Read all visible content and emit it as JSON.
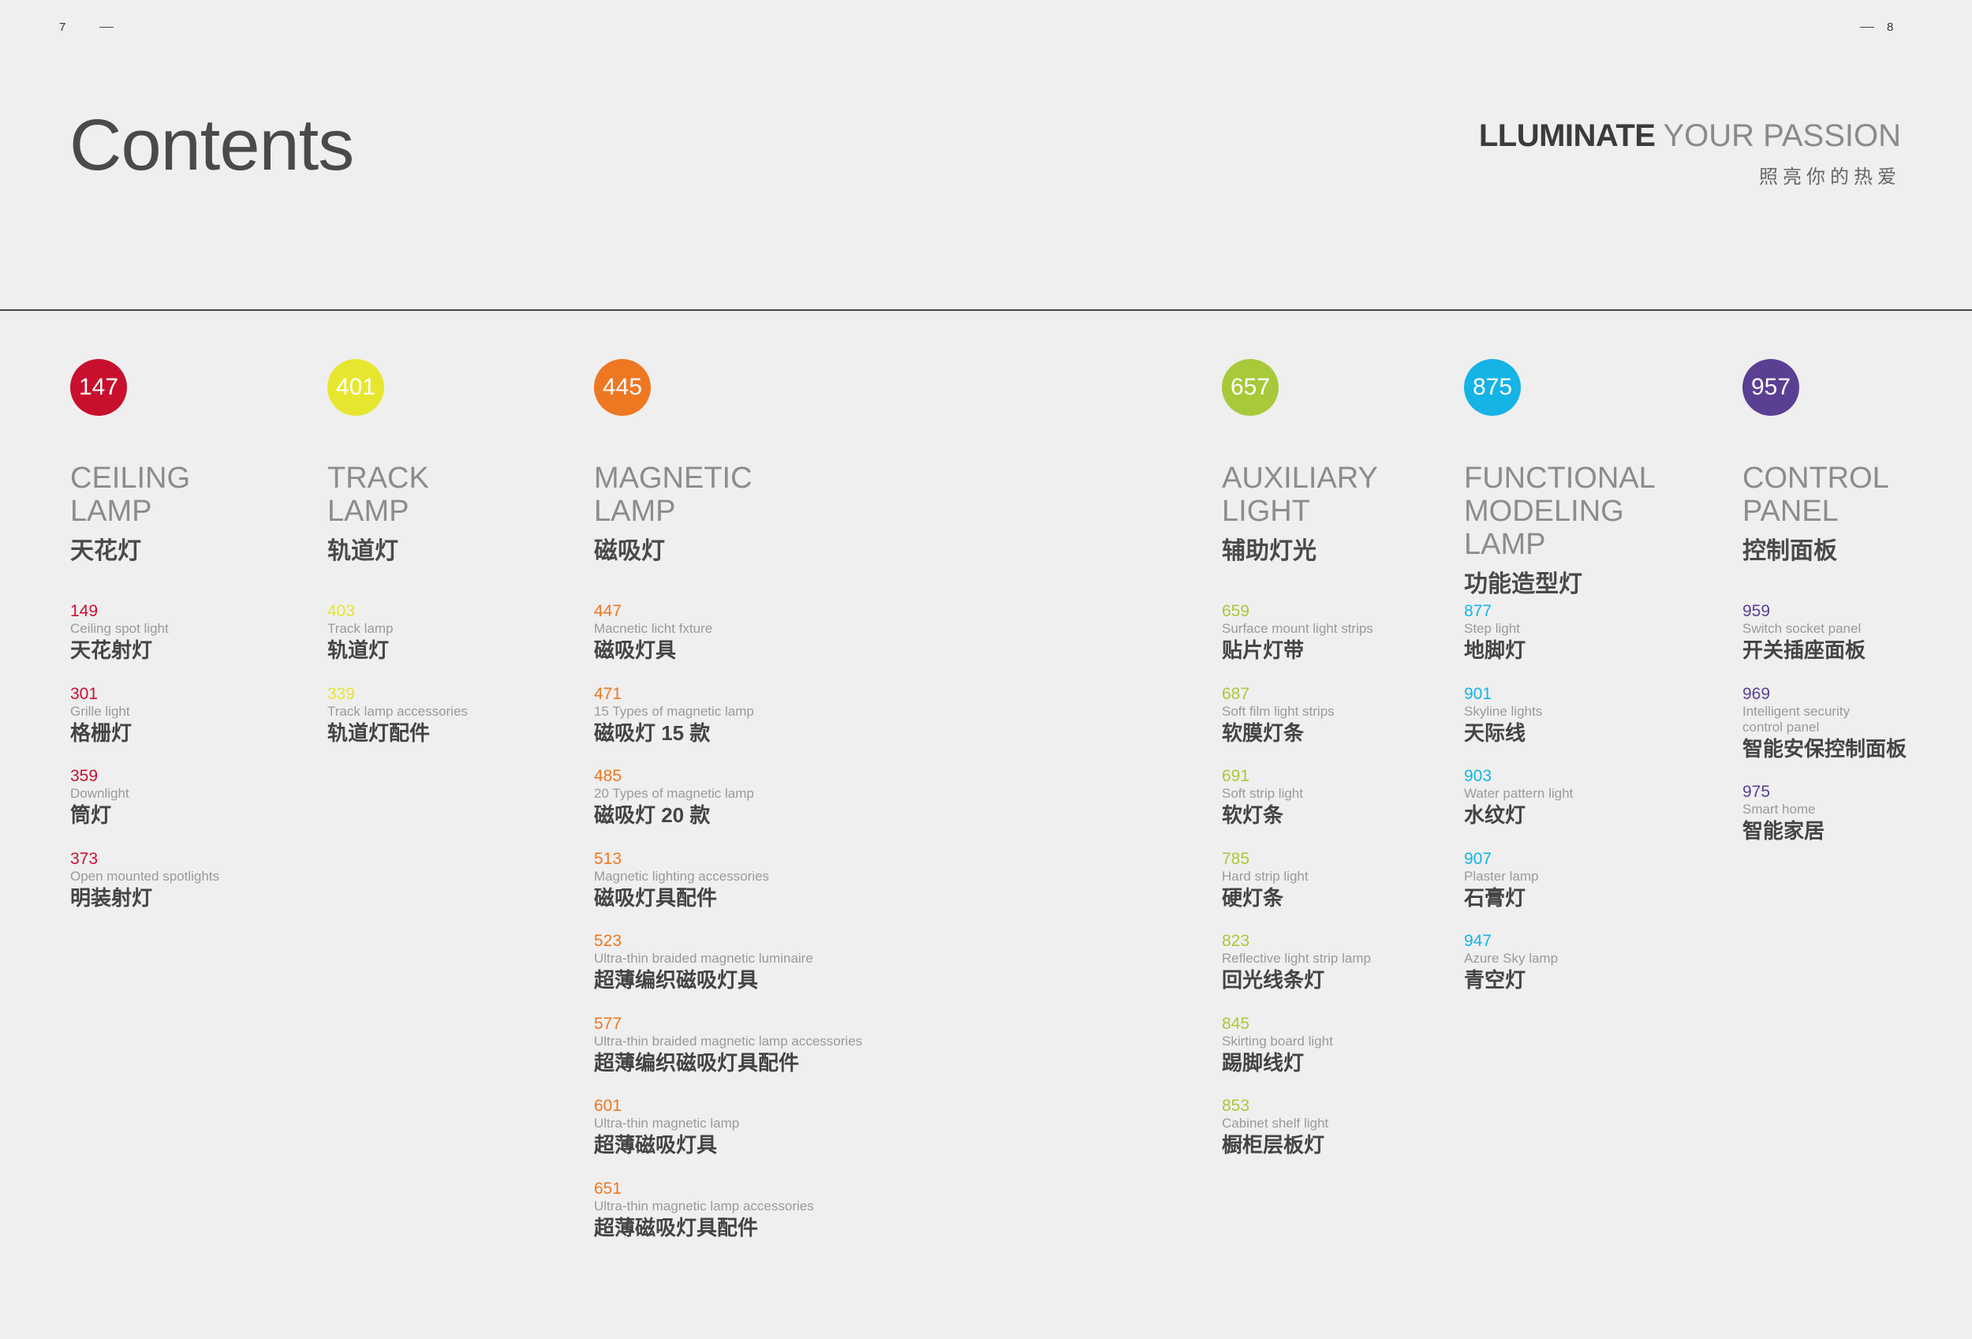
{
  "page": {
    "left_number": "7",
    "right_number": "8",
    "title": "Contents"
  },
  "slogan": {
    "bold": "LLUMINATE",
    "light": "YOUR PASSION",
    "cn": "照亮你的热爱"
  },
  "colors": {
    "ceiling": "#c8102e",
    "track": "#e7e62f",
    "magnetic": "#ee7722",
    "auxiliary": "#a8c93a",
    "functional": "#16b3e6",
    "control": "#5b3f92"
  },
  "categories": [
    {
      "page": "147",
      "en": "CEILING\nLAMP",
      "cn": "天花灯",
      "items": [
        {
          "num": "149",
          "en": "Ceiling spot light",
          "cn": "天花射灯"
        },
        {
          "num": "301",
          "en": "Grille light",
          "cn": "格栅灯"
        },
        {
          "num": "359",
          "en": "Downlight",
          "cn": "筒灯"
        },
        {
          "num": "373",
          "en": "Open mounted spotlights",
          "cn": "明装射灯"
        }
      ]
    },
    {
      "page": "401",
      "en": "TRACK\nLAMP",
      "cn": "轨道灯",
      "items": [
        {
          "num": "403",
          "en": "Track lamp",
          "cn": "轨道灯"
        },
        {
          "num": "339",
          "en": "Track lamp accessories",
          "cn": "轨道灯配件"
        }
      ]
    },
    {
      "page": "445",
      "en": "MAGNETIC\nLAMP",
      "cn": "磁吸灯",
      "items": [
        {
          "num": "447",
          "en": "Macnetic licht fxture",
          "cn": "磁吸灯具"
        },
        {
          "num": "471",
          "en": "15 Types of magnetic lamp",
          "cn": "磁吸灯 15 款"
        },
        {
          "num": "485",
          "en": "20 Types of magnetic lamp",
          "cn": "磁吸灯 20 款"
        },
        {
          "num": "513",
          "en": "Magnetic lighting accessories",
          "cn": "磁吸灯具配件"
        },
        {
          "num": "523",
          "en": "Ultra-thin braided magnetic luminaire",
          "cn": "超薄编织磁吸灯具"
        },
        {
          "num": "577",
          "en": "Ultra-thin braided magnetic lamp accessories",
          "cn": "超薄编织磁吸灯具配件"
        },
        {
          "num": "601",
          "en": "Ultra-thin magnetic lamp",
          "cn": "超薄磁吸灯具"
        },
        {
          "num": "651",
          "en": "Ultra-thin magnetic lamp accessories",
          "cn": "超薄磁吸灯具配件"
        }
      ]
    },
    {
      "page": "657",
      "en": "AUXILIARY\nLIGHT",
      "cn": "辅助灯光",
      "items": [
        {
          "num": "659",
          "en": "Surface mount light strips",
          "cn": "贴片灯带"
        },
        {
          "num": "687",
          "en": "Soft film light strips",
          "cn": "软膜灯条"
        },
        {
          "num": "691",
          "en": "Soft strip light",
          "cn": "软灯条"
        },
        {
          "num": "785",
          "en": "Hard strip light",
          "cn": "硬灯条"
        },
        {
          "num": "823",
          "en": "Reflective light strip lamp",
          "cn": "回光线条灯"
        },
        {
          "num": "845",
          "en": "Skirting board light",
          "cn": "踢脚线灯"
        },
        {
          "num": "853",
          "en": "Cabinet shelf light",
          "cn": "橱柜层板灯"
        }
      ]
    },
    {
      "page": "875",
      "en": "FUNCTIONAL\nMODELING\nLAMP",
      "cn": "功能造型灯",
      "items": [
        {
          "num": "877",
          "en": "Step light",
          "cn": "地脚灯"
        },
        {
          "num": "901",
          "en": "Skyline lights",
          "cn": "天际线"
        },
        {
          "num": "903",
          "en": "Water pattern light",
          "cn": "水纹灯"
        },
        {
          "num": "907",
          "en": "Plaster lamp",
          "cn": "石膏灯"
        },
        {
          "num": "947",
          "en": "Azure Sky lamp",
          "cn": "青空灯"
        }
      ]
    },
    {
      "page": "957",
      "en": "CONTROL\nPANEL",
      "cn": "控制面板",
      "items": [
        {
          "num": "959",
          "en": "Switch socket panel",
          "cn": "开关插座面板"
        },
        {
          "num": "969",
          "en": "Intelligent security\ncontrol panel",
          "cn": "智能安保控制面板"
        },
        {
          "num": "975",
          "en": "Smart home",
          "cn": "智能家居"
        }
      ]
    }
  ]
}
